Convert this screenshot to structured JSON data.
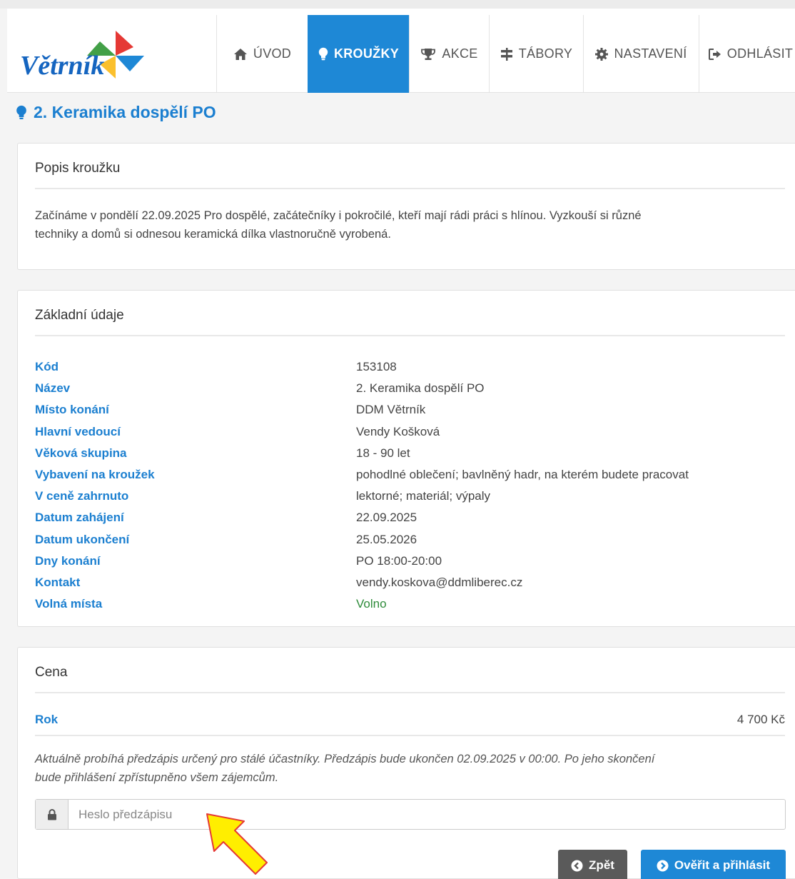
{
  "brand": {
    "name": "Větrník"
  },
  "nav": {
    "items": [
      {
        "label": "ÚVOD",
        "icon": "home-icon"
      },
      {
        "label": "KROUŽKY",
        "icon": "lightbulb-icon",
        "active": true
      },
      {
        "label": "AKCE",
        "icon": "trophy-icon"
      },
      {
        "label": "TÁBORY",
        "icon": "signpost-icon"
      },
      {
        "label": "NASTAVENÍ",
        "icon": "gear-icon"
      },
      {
        "label": "ODHLÁSIT",
        "icon": "sign-out-icon"
      }
    ]
  },
  "page": {
    "title": "2. Keramika dospělí PO",
    "title_icon": "lightbulb-icon"
  },
  "description": {
    "heading": "Popis kroužku",
    "text_line1": "Začínáme v pondělí 22.09.2025 Pro dospělé, začátečníky i pokročilé, kteří mají rádi práci s hlínou. Vyzkouší si různé",
    "text_line2": "techniky a domů si odnesou keramická dílka vlastnoručně vyrobená."
  },
  "details": {
    "heading": "Základní údaje",
    "rows": [
      {
        "label": "Kód",
        "value": "153108"
      },
      {
        "label": "Název",
        "value": "2. Keramika dospělí PO"
      },
      {
        "label": "Místo konání",
        "value": "DDM Větrník"
      },
      {
        "label": "Hlavní vedoucí",
        "value": "Vendy Košková"
      },
      {
        "label": "Věková skupina",
        "value": "18 - 90 let"
      },
      {
        "label": "Vybavení na kroužek",
        "value": "pohodlné oblečení; bavlněný hadr, na kterém budete pracovat"
      },
      {
        "label": "V ceně zahrnuto",
        "value": "lektorné; materiál; výpaly"
      },
      {
        "label": "Datum zahájení",
        "value": "22.09.2025"
      },
      {
        "label": "Datum ukončení",
        "value": "25.05.2026"
      },
      {
        "label": "Dny konání",
        "value": "PO 18:00-20:00"
      },
      {
        "label": "Kontakt",
        "value": "vendy.koskova@ddmliberec.cz"
      },
      {
        "label": "Volná místa",
        "value": "Volno"
      }
    ]
  },
  "price": {
    "heading": "Cena",
    "label": "Rok",
    "value": "4 700 Kč",
    "note_line1": "Aktuálně probíhá předzápis určený pro stálé účastníky. Předzápis bude ukončen 02.09.2025 v 00:00. Po jeho skončení",
    "note_line2": "bude přihlášení zpřístupněno všem zájemcům.",
    "password_placeholder": "Heslo předzápisu",
    "password_value": "",
    "back_label": "Zpět",
    "login_label": "Ověřit a přihlásit"
  },
  "colors": {
    "accent": "#1e88d6",
    "link": "#1b7fd0",
    "available": "#2e8b3a",
    "back_button": "#5a5a5a",
    "arrow": "#ffee00"
  }
}
